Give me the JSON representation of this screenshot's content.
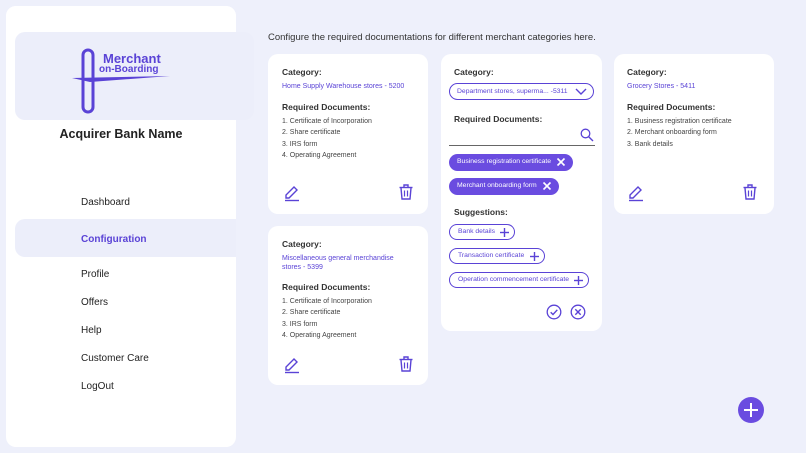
{
  "sidebar": {
    "logo_line1": "Merchant",
    "logo_line2": "on-Boarding",
    "bank_name": "Acquirer Bank Name",
    "nav": {
      "dashboard": "Dashboard",
      "configuration": "Configuration",
      "profile": "Profile",
      "offers": "Offers",
      "help": "Help",
      "customer_care": "Customer Care",
      "logout": "LogOut"
    },
    "active_item": "Configuration"
  },
  "main": {
    "intro": "Configure the required documentations for different merchant categories here.",
    "category_label": "Category:",
    "required_label": "Required Documents:",
    "cards": [
      {
        "category": "Home Supply Warehouse stores - 5200",
        "documents": [
          "1. Certificate of Incorporation",
          "2. Share certificate",
          "3. IRS form",
          "4. Operating Agreement"
        ]
      },
      {
        "category_line1": "Miscellaneous general merchandise",
        "category_line2": "stores - 5399",
        "documents": [
          "1. Certificate of Incorporation",
          "2. Share certificate",
          "3. IRS form",
          "4. Operating Agreement"
        ]
      },
      {
        "category": "Grocery Stores - 5411",
        "documents": [
          "1. Business registration certificate",
          "2. Merchant onboarding form",
          "3. Bank details"
        ]
      }
    ],
    "editor": {
      "selected_category": "Department stores, superma... -5311",
      "search_placeholder": "",
      "chips": [
        "Business registration certificate",
        "Merchant onboarding form"
      ],
      "suggestions_label": "Suggestions:",
      "suggestions": [
        "Bank details",
        "Transaction certificate",
        "Operation commencement certificate"
      ]
    }
  },
  "colors": {
    "accent": "#6a4ce0",
    "background": "#eef0fb",
    "card": "#ffffff"
  },
  "icons": [
    "edit-icon",
    "delete-icon",
    "search-icon",
    "chevron-down-icon",
    "close-icon",
    "plus-icon",
    "check-icon",
    "cancel-icon",
    "add-icon"
  ]
}
